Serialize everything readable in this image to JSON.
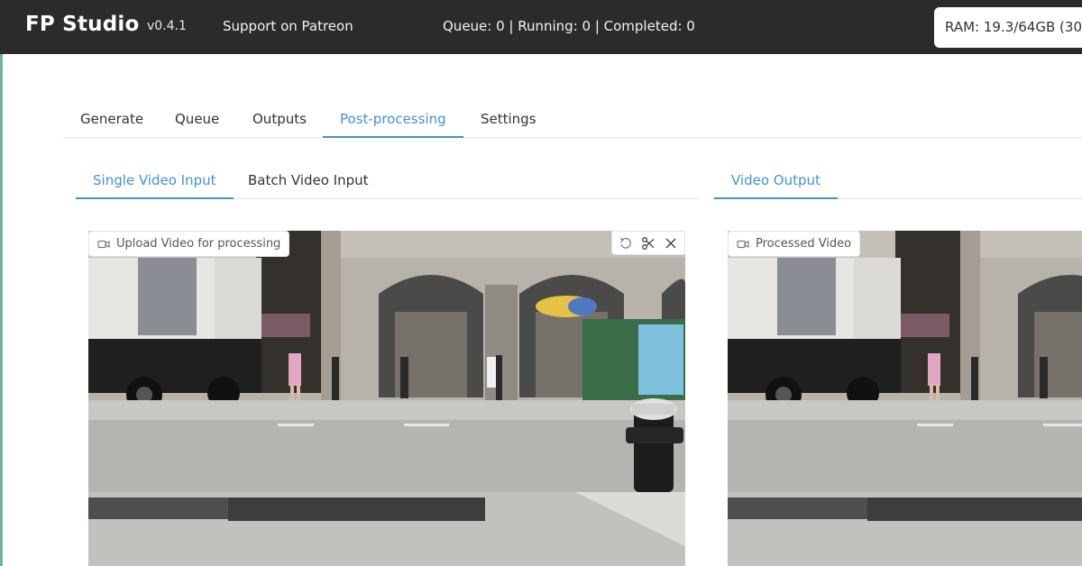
{
  "app": {
    "title": "FP Studio",
    "version": "v0.4.1",
    "patreon_link": "Support on Patreon",
    "queue_status": "Queue: 0 | Running: 0 | Completed: 0",
    "ram_status": "RAM: 19.3/64GB (30"
  },
  "main_tabs": [
    {
      "label": "Generate"
    },
    {
      "label": "Queue"
    },
    {
      "label": "Outputs"
    },
    {
      "label": "Post-processing",
      "active": true
    },
    {
      "label": "Settings"
    }
  ],
  "input_tabs": [
    {
      "label": "Single Video Input",
      "active": true
    },
    {
      "label": "Batch Video Input"
    }
  ],
  "output_tabs": [
    {
      "label": "Video Output",
      "active": true
    }
  ],
  "input_video": {
    "label": "Upload Video for processing",
    "icon": "video-camera-icon",
    "tools": [
      "undo-icon",
      "scissors-icon",
      "close-icon"
    ]
  },
  "output_video": {
    "label": "Processed Video",
    "icon": "video-camera-icon"
  },
  "colors": {
    "topbar": "#2b2b2b",
    "accent": "#4a8fd0",
    "left_accent": "#6fb39a"
  }
}
